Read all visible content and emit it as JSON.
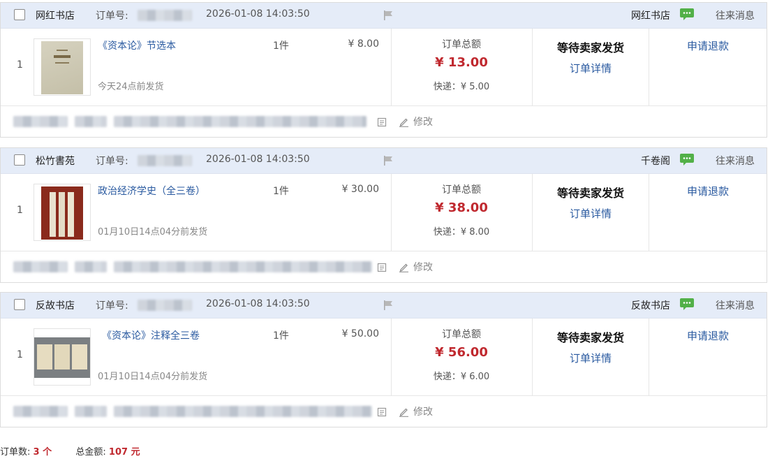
{
  "labels": {
    "order_no": "订单号:",
    "messages": "往来消息",
    "total_label": "订单总额",
    "status": "等待卖家发货",
    "detail": "订单详情",
    "refund": "申请退款",
    "edit": "修改"
  },
  "orders": [
    {
      "index": "1",
      "shop": "网红书店",
      "time": "2026-01-08 14:03:50",
      "seller": "网红书店",
      "title": "《资本论》节选本",
      "qty": "1件",
      "price": "¥ 8.00",
      "ship_time": "今天24点前发货",
      "total": "¥ 13.00",
      "shipping": "快递：¥ 5.00"
    },
    {
      "index": "1",
      "shop": "松竹書苑",
      "time": "2026-01-08 14:03:50",
      "seller": "千卷阁",
      "title": "政治经济学史（全三卷）",
      "qty": "1件",
      "price": "¥ 30.00",
      "ship_time": "01月10日14点04分前发货",
      "total": "¥ 38.00",
      "shipping": "快递：¥ 8.00"
    },
    {
      "index": "1",
      "shop": "反故书店",
      "time": "2026-01-08 14:03:50",
      "seller": "反故书店",
      "title": "《资本论》注释全三卷",
      "qty": "1件",
      "price": "¥ 50.00",
      "ship_time": "01月10日14点04分前发货",
      "total": "¥ 56.00",
      "shipping": "快递：¥ 6.00"
    }
  ],
  "summary": {
    "count_label": "订单数:",
    "count_value": "3 个",
    "amount_label": "总金额:",
    "amount_value": "107 元"
  },
  "colors": {
    "accent": "#c0292f",
    "link": "#2a5aa0",
    "header_bg": "#e5ecf8",
    "chat_icon": "#52b048"
  },
  "icons": [
    "checkbox",
    "flag-icon",
    "chat-icon",
    "note-icon",
    "edit-icon"
  ]
}
